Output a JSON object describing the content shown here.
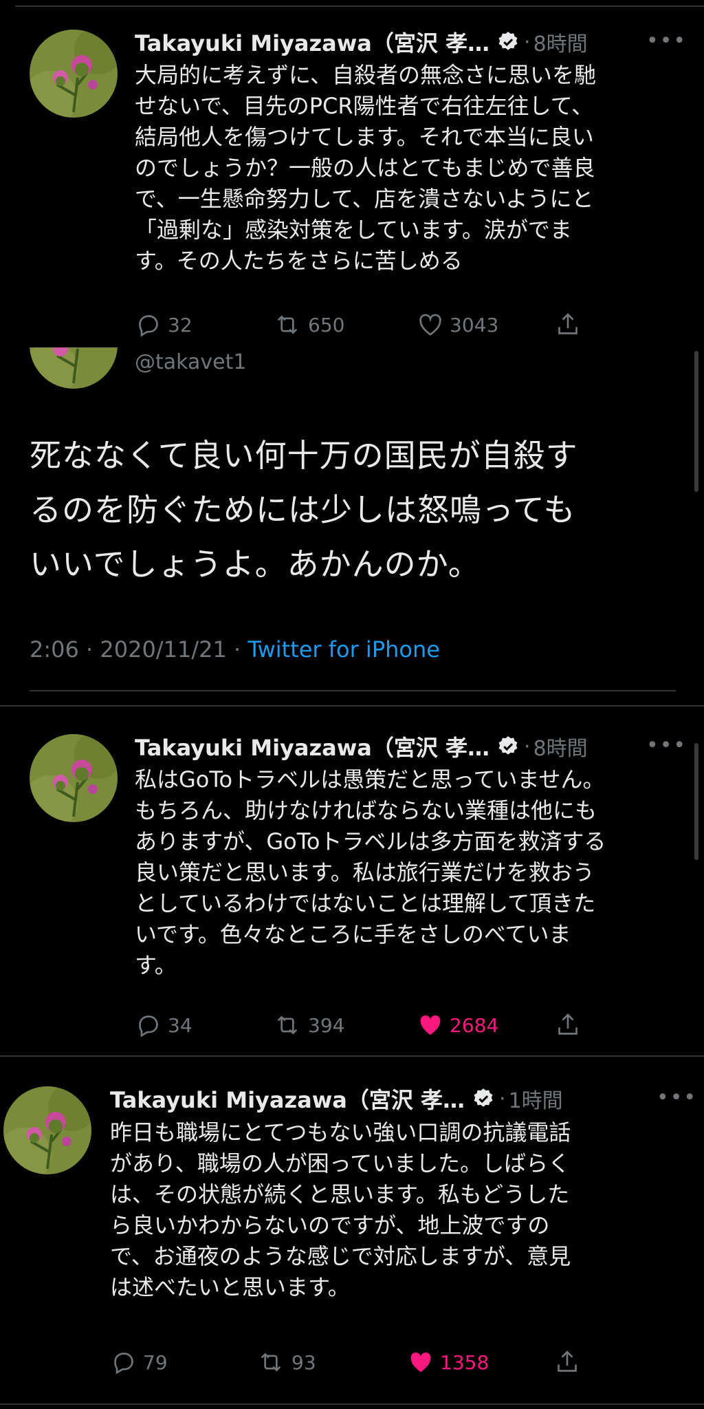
{
  "colors": {
    "background": "#000000",
    "text": "#e7e9ea",
    "muted": "#71767b",
    "link": "#1d9bf0",
    "like": "#f91880",
    "separator": "#2f3336"
  },
  "tweets": [
    {
      "name": "Takayuki Miyazawa（宮沢 孝…",
      "time": "8時間",
      "text": "大局的に考えずに、自殺者の無念さに思いを馳\nせないで、目先のPCR陽性者で右往左往して、\n結局他人を傷つけてします。それで本当に良い\nのでしょうか？一般の人はとてもまじめで善良\nで、一生懸命努力して、店を潰さないようにと\n「過剰な」感染対策をしています。涙がでま\nす。その人たちをさらに苦しめる",
      "replies": "32",
      "retweets": "650",
      "likes": "3043",
      "liked": false
    },
    {
      "name": "Takayuki Miyazawa（宮沢 孝…",
      "time": "8時間",
      "text": "私はGoToトラベルは愚策だと思っていません。\nもちろん、助けなければならない業種は他にも\nありますが、GoToトラベルは多方面を救済する\n良い策だと思います。私は旅行業だけを救おう\nとしているわけではないことは理解して頂きた\nいです。色々なところに手をさしのべていま\nす。",
      "replies": "34",
      "retweets": "394",
      "likes": "2684",
      "liked": true
    },
    {
      "name": "Takayuki Miyazawa（宮沢 孝…",
      "time": "1時間",
      "text": "昨日も職場にとてつもない強い口調の抗議電話\nがあり、職場の人が困っていました。しばらく\nは、その状態が続くと思います。私もどうした\nら良いかわからないのですが、地上波ですの\nで、お通夜のような感じで対応しますが、意見\nは述べたいと思います。",
      "replies": "79",
      "retweets": "93",
      "likes": "1358",
      "liked": true
    }
  ],
  "focused": {
    "handle": "@takavet1",
    "text": "死ななくて良い何十万の国民が自殺す\nるのを防ぐためには少しは怒鳴っても\nいいでしょうよ。あかんのか。",
    "timestamp": "2:06 · 2020/11/21 · ",
    "source": "Twitter for iPhone"
  },
  "ui": {
    "dot": "·",
    "more": "•••"
  },
  "icons": [
    "avatar-thistle",
    "verified-badge-icon",
    "reply-icon",
    "retweet-icon",
    "like-icon",
    "share-icon"
  ]
}
